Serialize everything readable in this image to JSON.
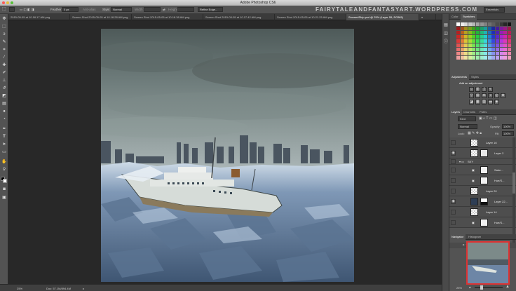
{
  "window": {
    "title": "Adobe Photoshop CS6",
    "watermark": "FAIRYTALEANDFANTASYART.WORDPRESS.COM"
  },
  "options_bar": {
    "feather_label": "Feather:",
    "feather_value": "0 px",
    "antialias_label": "Anti-alias",
    "style_label": "Style:",
    "style_value": "Normal",
    "width_label": "Width:",
    "height_label": "Height:",
    "refine_edge": "Refine Edge...",
    "workspace": "Essentials"
  },
  "tabs": [
    {
      "label": "2015-05-05 at 10.18.17 AM.png"
    },
    {
      "label": "Screen Shot 2015-05-05 at 10.18.28 AM.png"
    },
    {
      "label": "Screen Shot 2015-05-05 at 10.18.38 AM.png"
    },
    {
      "label": "Screen Shot 2015-05-05 at 10.17.42 AM.png"
    },
    {
      "label": "Screen Shot 2015-05-05 at 10.21.25 AM.png"
    },
    {
      "label": "SnowedShip.psd @ 25% (Layer 55, RGB/8)"
    }
  ],
  "status": {
    "zoom": "25%",
    "doc": "Doc: 57.1M/894.4M"
  },
  "panels": {
    "swatches_tabs": [
      "Color",
      "Swatches"
    ],
    "adjust_tabs": [
      "Adjustments",
      "Styles"
    ],
    "adjust_heading": "Add an adjustment",
    "layer_tabs": [
      "Layers",
      "Channels",
      "Paths"
    ],
    "kind_label": "Kind",
    "blend_mode": "Normal",
    "opacity_label": "Opacity:",
    "opacity_value": "100%",
    "lock_label": "Lock:",
    "fill_label": "Fill:",
    "fill_value": "100%",
    "nav_tabs": [
      "Navigator",
      "Histogram"
    ],
    "nav_zoom": "25%"
  },
  "layers": [
    {
      "name": "Layer 16"
    },
    {
      "name": "Layer 2"
    },
    {
      "name": "SKY"
    },
    {
      "name": "Satur..."
    },
    {
      "name": "Hue/S..."
    },
    {
      "name": "Layer 20"
    },
    {
      "name": "Layer 22..."
    },
    {
      "name": "Layer 14"
    },
    {
      "name": "Hue/S..."
    }
  ],
  "colors": {
    "accent": "#4f5b70",
    "panel": "#535353",
    "canvas_bg": "#282828"
  }
}
